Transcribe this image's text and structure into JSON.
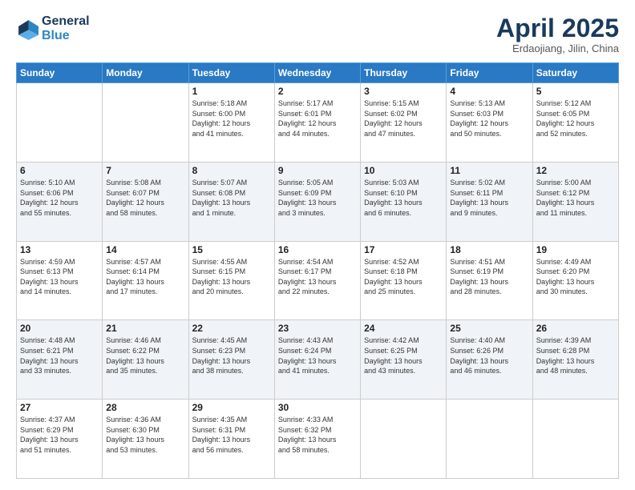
{
  "header": {
    "logo_line1": "General",
    "logo_line2": "Blue",
    "month": "April 2025",
    "location": "Erdaojiang, Jilin, China"
  },
  "weekdays": [
    "Sunday",
    "Monday",
    "Tuesday",
    "Wednesday",
    "Thursday",
    "Friday",
    "Saturday"
  ],
  "weeks": [
    [
      {
        "day": "",
        "info": ""
      },
      {
        "day": "",
        "info": ""
      },
      {
        "day": "1",
        "info": "Sunrise: 5:18 AM\nSunset: 6:00 PM\nDaylight: 12 hours\nand 41 minutes."
      },
      {
        "day": "2",
        "info": "Sunrise: 5:17 AM\nSunset: 6:01 PM\nDaylight: 12 hours\nand 44 minutes."
      },
      {
        "day": "3",
        "info": "Sunrise: 5:15 AM\nSunset: 6:02 PM\nDaylight: 12 hours\nand 47 minutes."
      },
      {
        "day": "4",
        "info": "Sunrise: 5:13 AM\nSunset: 6:03 PM\nDaylight: 12 hours\nand 50 minutes."
      },
      {
        "day": "5",
        "info": "Sunrise: 5:12 AM\nSunset: 6:05 PM\nDaylight: 12 hours\nand 52 minutes."
      }
    ],
    [
      {
        "day": "6",
        "info": "Sunrise: 5:10 AM\nSunset: 6:06 PM\nDaylight: 12 hours\nand 55 minutes."
      },
      {
        "day": "7",
        "info": "Sunrise: 5:08 AM\nSunset: 6:07 PM\nDaylight: 12 hours\nand 58 minutes."
      },
      {
        "day": "8",
        "info": "Sunrise: 5:07 AM\nSunset: 6:08 PM\nDaylight: 13 hours\nand 1 minute."
      },
      {
        "day": "9",
        "info": "Sunrise: 5:05 AM\nSunset: 6:09 PM\nDaylight: 13 hours\nand 3 minutes."
      },
      {
        "day": "10",
        "info": "Sunrise: 5:03 AM\nSunset: 6:10 PM\nDaylight: 13 hours\nand 6 minutes."
      },
      {
        "day": "11",
        "info": "Sunrise: 5:02 AM\nSunset: 6:11 PM\nDaylight: 13 hours\nand 9 minutes."
      },
      {
        "day": "12",
        "info": "Sunrise: 5:00 AM\nSunset: 6:12 PM\nDaylight: 13 hours\nand 11 minutes."
      }
    ],
    [
      {
        "day": "13",
        "info": "Sunrise: 4:59 AM\nSunset: 6:13 PM\nDaylight: 13 hours\nand 14 minutes."
      },
      {
        "day": "14",
        "info": "Sunrise: 4:57 AM\nSunset: 6:14 PM\nDaylight: 13 hours\nand 17 minutes."
      },
      {
        "day": "15",
        "info": "Sunrise: 4:55 AM\nSunset: 6:15 PM\nDaylight: 13 hours\nand 20 minutes."
      },
      {
        "day": "16",
        "info": "Sunrise: 4:54 AM\nSunset: 6:17 PM\nDaylight: 13 hours\nand 22 minutes."
      },
      {
        "day": "17",
        "info": "Sunrise: 4:52 AM\nSunset: 6:18 PM\nDaylight: 13 hours\nand 25 minutes."
      },
      {
        "day": "18",
        "info": "Sunrise: 4:51 AM\nSunset: 6:19 PM\nDaylight: 13 hours\nand 28 minutes."
      },
      {
        "day": "19",
        "info": "Sunrise: 4:49 AM\nSunset: 6:20 PM\nDaylight: 13 hours\nand 30 minutes."
      }
    ],
    [
      {
        "day": "20",
        "info": "Sunrise: 4:48 AM\nSunset: 6:21 PM\nDaylight: 13 hours\nand 33 minutes."
      },
      {
        "day": "21",
        "info": "Sunrise: 4:46 AM\nSunset: 6:22 PM\nDaylight: 13 hours\nand 35 minutes."
      },
      {
        "day": "22",
        "info": "Sunrise: 4:45 AM\nSunset: 6:23 PM\nDaylight: 13 hours\nand 38 minutes."
      },
      {
        "day": "23",
        "info": "Sunrise: 4:43 AM\nSunset: 6:24 PM\nDaylight: 13 hours\nand 41 minutes."
      },
      {
        "day": "24",
        "info": "Sunrise: 4:42 AM\nSunset: 6:25 PM\nDaylight: 13 hours\nand 43 minutes."
      },
      {
        "day": "25",
        "info": "Sunrise: 4:40 AM\nSunset: 6:26 PM\nDaylight: 13 hours\nand 46 minutes."
      },
      {
        "day": "26",
        "info": "Sunrise: 4:39 AM\nSunset: 6:28 PM\nDaylight: 13 hours\nand 48 minutes."
      }
    ],
    [
      {
        "day": "27",
        "info": "Sunrise: 4:37 AM\nSunset: 6:29 PM\nDaylight: 13 hours\nand 51 minutes."
      },
      {
        "day": "28",
        "info": "Sunrise: 4:36 AM\nSunset: 6:30 PM\nDaylight: 13 hours\nand 53 minutes."
      },
      {
        "day": "29",
        "info": "Sunrise: 4:35 AM\nSunset: 6:31 PM\nDaylight: 13 hours\nand 56 minutes."
      },
      {
        "day": "30",
        "info": "Sunrise: 4:33 AM\nSunset: 6:32 PM\nDaylight: 13 hours\nand 58 minutes."
      },
      {
        "day": "",
        "info": ""
      },
      {
        "day": "",
        "info": ""
      },
      {
        "day": "",
        "info": ""
      }
    ]
  ]
}
